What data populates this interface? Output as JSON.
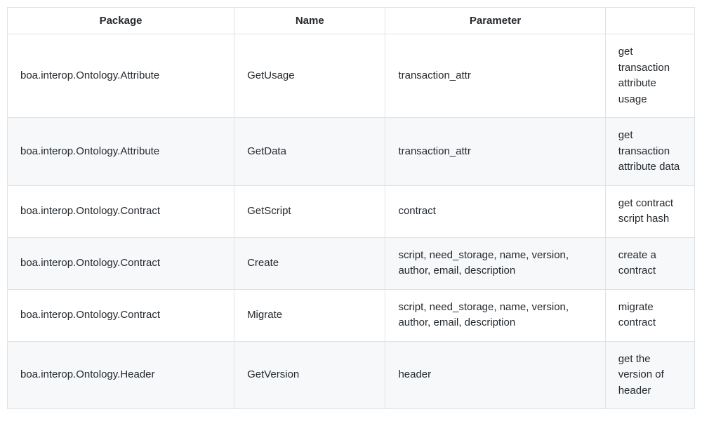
{
  "table": {
    "headers": {
      "package": "Package",
      "name": "Name",
      "parameter": "Parameter",
      "description": ""
    },
    "rows": [
      {
        "package": "boa.interop.Ontology.Attribute",
        "name": "GetUsage",
        "parameter": "transaction_attr",
        "description": "get transaction attribute usage"
      },
      {
        "package": "boa.interop.Ontology.Attribute",
        "name": "GetData",
        "parameter": "transaction_attr",
        "description": "get transaction attribute data"
      },
      {
        "package": "boa.interop.Ontology.Contract",
        "name": "GetScript",
        "parameter": "contract",
        "description": "get contract script hash"
      },
      {
        "package": "boa.interop.Ontology.Contract",
        "name": "Create",
        "parameter": "script, need_storage, name, version, author, email, description",
        "description": "create a contract"
      },
      {
        "package": "boa.interop.Ontology.Contract",
        "name": "Migrate",
        "parameter": "script, need_storage, name, version, author, email, description",
        "description": "migrate contract"
      },
      {
        "package": "boa.interop.Ontology.Header",
        "name": "GetVersion",
        "parameter": "header",
        "description": "get the version of header"
      }
    ]
  }
}
